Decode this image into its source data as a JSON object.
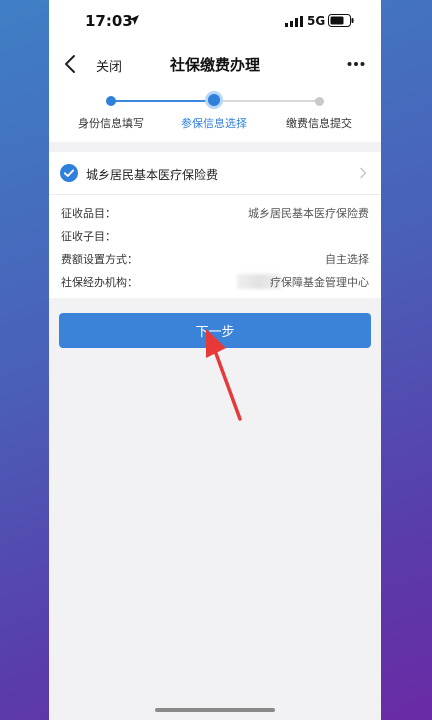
{
  "status_bar": {
    "time": "17:03",
    "network": "5G"
  },
  "nav": {
    "close_label": "关闭",
    "title": "社保缴费办理"
  },
  "steps": [
    {
      "label": "身份信息填写",
      "state": "done"
    },
    {
      "label": "参保信息选择",
      "state": "active"
    },
    {
      "label": "缴费信息提交",
      "state": "pending"
    }
  ],
  "card": {
    "title": "城乡居民基本医疗保险费",
    "rows": [
      {
        "label": "征收品目：",
        "value": "城乡居民基本医疗保险费"
      },
      {
        "label": "征收子目：",
        "value": ""
      },
      {
        "label": "费额设置方式：",
        "value": "自主选择"
      },
      {
        "label": "社保经办机构：",
        "value": "疗保障基金管理中心"
      }
    ]
  },
  "next_button": {
    "label": "下一步"
  },
  "colors": {
    "accent": "#3b82d9",
    "annotation_arrow": "#e8393a",
    "step_inactive": "#c9c9c9"
  }
}
